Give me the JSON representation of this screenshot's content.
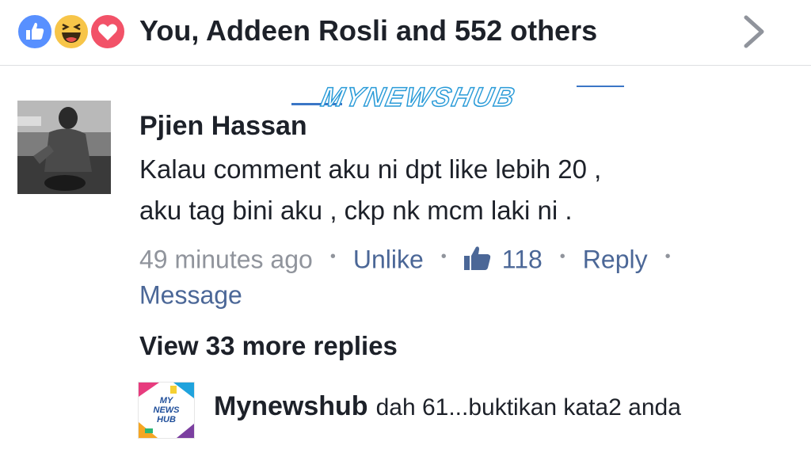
{
  "reactions": {
    "icons": [
      "like-icon",
      "haha-icon",
      "love-icon"
    ],
    "summary": "You, Addeen Rosli and 552 others",
    "colors": {
      "like": "#5890ff",
      "haha": "#f7c549",
      "love": "#f25268"
    }
  },
  "watermark": {
    "text": "MYNEWSHUB"
  },
  "comment": {
    "author": "Pjien Hassan",
    "text_line1": "Kalau comment aku ni dpt like lebih 20 ,",
    "text_line2": "aku tag bini aku , ckp nk mcm laki ni .",
    "time": "49 minutes ago",
    "unlike_label": "Unlike",
    "like_count": "118",
    "reply_label": "Reply",
    "message_label": "Message",
    "separator": "•"
  },
  "replies": {
    "view_more": "View 33 more replies",
    "latest": {
      "author": "Mynewshub",
      "text": "dah 61...buktikan kata2 anda",
      "avatar_text": "MY NEWS HUB"
    }
  },
  "colors": {
    "link": "#4b6797",
    "meta": "#90949c",
    "text": "#1d2129"
  }
}
